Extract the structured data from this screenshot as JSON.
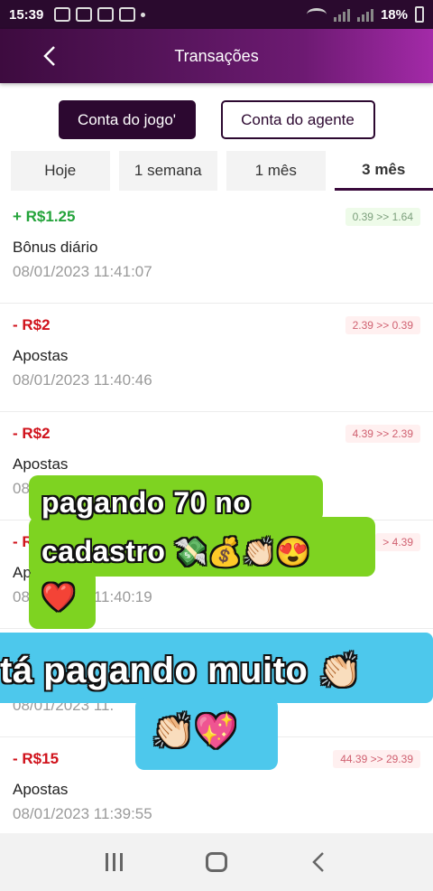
{
  "status_bar": {
    "time": "15:39",
    "battery": "18%"
  },
  "header": {
    "title": "Transações",
    "back_icon": "chevron-left-icon"
  },
  "account_toggle": {
    "game_account": "Conta do jogo'",
    "agent_account": "Conta do agente",
    "selected": "game_account"
  },
  "tabs": [
    {
      "label": "Hoje",
      "active": false
    },
    {
      "label": "1 semana",
      "active": false
    },
    {
      "label": "1 mês",
      "active": false
    },
    {
      "label": "3 mês",
      "active": true
    }
  ],
  "transactions": [
    {
      "amount": "+ R$1.25",
      "type": "credit",
      "balance": "0.39 >> 1.64",
      "description": "Bônus diário",
      "date": "08/01/2023 11:41:07"
    },
    {
      "amount": "- R$2",
      "type": "debit",
      "balance": "2.39 >> 0.39",
      "description": "Apostas",
      "date": "08/01/2023 11:40:46"
    },
    {
      "amount": "- R$2",
      "type": "debit",
      "balance": "4.39 >> 2.39",
      "description": "Apostas",
      "date": "08"
    },
    {
      "amount": "- R",
      "type": "debit",
      "balance": "> 4.39",
      "description": "Ap",
      "date": "08/01/2023 11:40:19"
    },
    {
      "amount": "",
      "type": "debit",
      "balance": "",
      "description": "",
      "date": "08/01/2023 11."
    },
    {
      "amount": "- R$15",
      "type": "debit",
      "balance": "44.39 >> 29.39",
      "description": "Apostas",
      "date": "08/01/2023 11:39:55"
    }
  ],
  "captions": {
    "line1": "pagando 70 no",
    "line2": "cadastro",
    "line2_emoji": "💸💰👏🏻😍",
    "line3_emoji": "❤️",
    "line4": "tá pagando muito",
    "line4_emoji": "👏🏻",
    "line5_emoji": "👏🏻💖"
  },
  "navbar": {
    "recent": "recent-apps-icon",
    "home": "home-icon",
    "back": "back-icon"
  }
}
